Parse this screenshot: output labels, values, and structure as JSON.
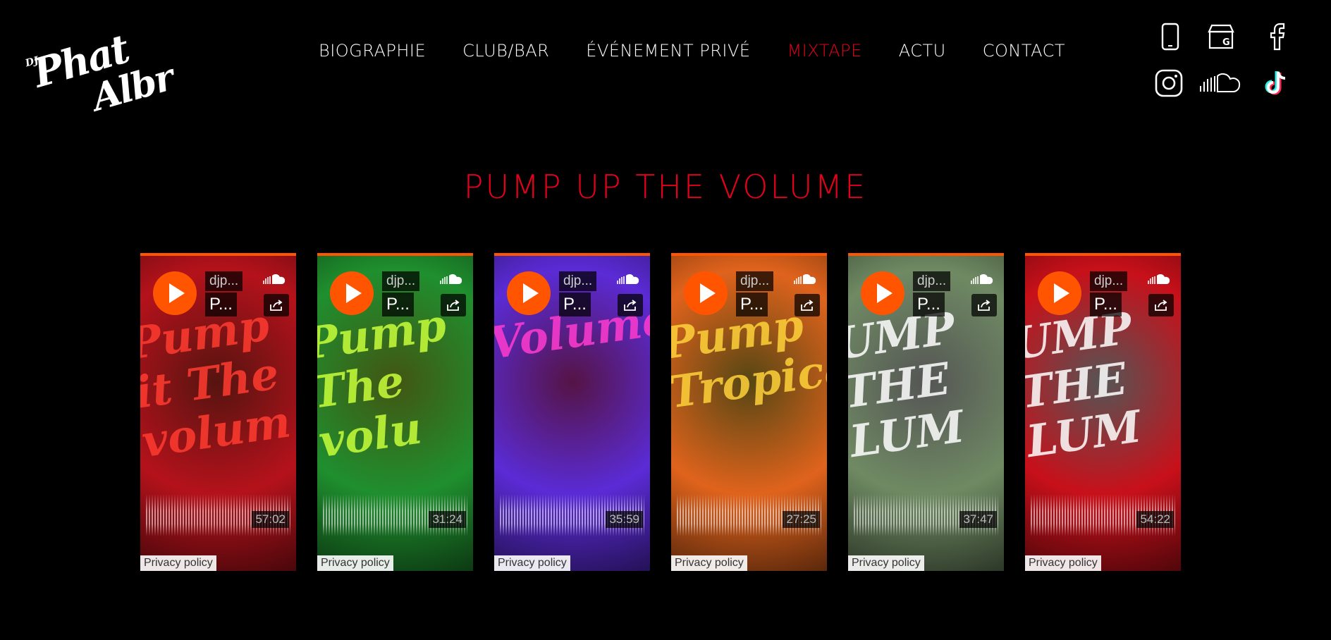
{
  "logo": {
    "dj": "DJ",
    "phat": "Phat",
    "albr": "Albr"
  },
  "nav": [
    {
      "label": "BIOGRAPHIE"
    },
    {
      "label": "CLUB/BAR"
    },
    {
      "label": "ÉVÉNEMENT PRIVÉ"
    },
    {
      "label": "MIXTAPE",
      "active": true
    },
    {
      "label": "ACTU"
    },
    {
      "label": "CONTACT"
    }
  ],
  "socials": [
    "phone-icon",
    "google-business-icon",
    "facebook-icon",
    "instagram-icon",
    "soundcloud-icon",
    "tiktok-icon"
  ],
  "page_title": "PUMP UP THE VOLUME",
  "accent": "#e3001b",
  "soundcloud_orange": "#ff5500",
  "players": [
    {
      "user": "djp...",
      "track": "P...",
      "duration": "57:02",
      "privacy": "Privacy policy",
      "cover_text": "Pump it The volum",
      "bg": "#b5121b",
      "fg": "#ff3b30"
    },
    {
      "user": "djp...",
      "track": "P...",
      "duration": "31:24",
      "privacy": "Privacy policy",
      "cover_text": "Pump The volu",
      "bg": "#1f8f2e",
      "fg": "#c8ff3a"
    },
    {
      "user": "djp...",
      "track": "P...",
      "duration": "35:59",
      "privacy": "Privacy policy",
      "cover_text": "Volume",
      "bg": "#5b2bd6",
      "fg": "#ff3bd0"
    },
    {
      "user": "djp...",
      "track": "P...",
      "duration": "27:25",
      "privacy": "Privacy policy",
      "cover_text": "Pump Tropical",
      "bg": "#e0631c",
      "fg": "#ffd23a"
    },
    {
      "user": "djp...",
      "track": "P...",
      "duration": "37:47",
      "privacy": "Privacy policy",
      "cover_text": "UMP THE LUM",
      "bg": "#6f8a63",
      "fg": "#ffffff"
    },
    {
      "user": "djp...",
      "track": "P...",
      "duration": "54:22",
      "privacy": "Privacy policy",
      "cover_text": "UMP THE LUM",
      "bg": "#c8101a",
      "fg": "#ffffff"
    }
  ]
}
